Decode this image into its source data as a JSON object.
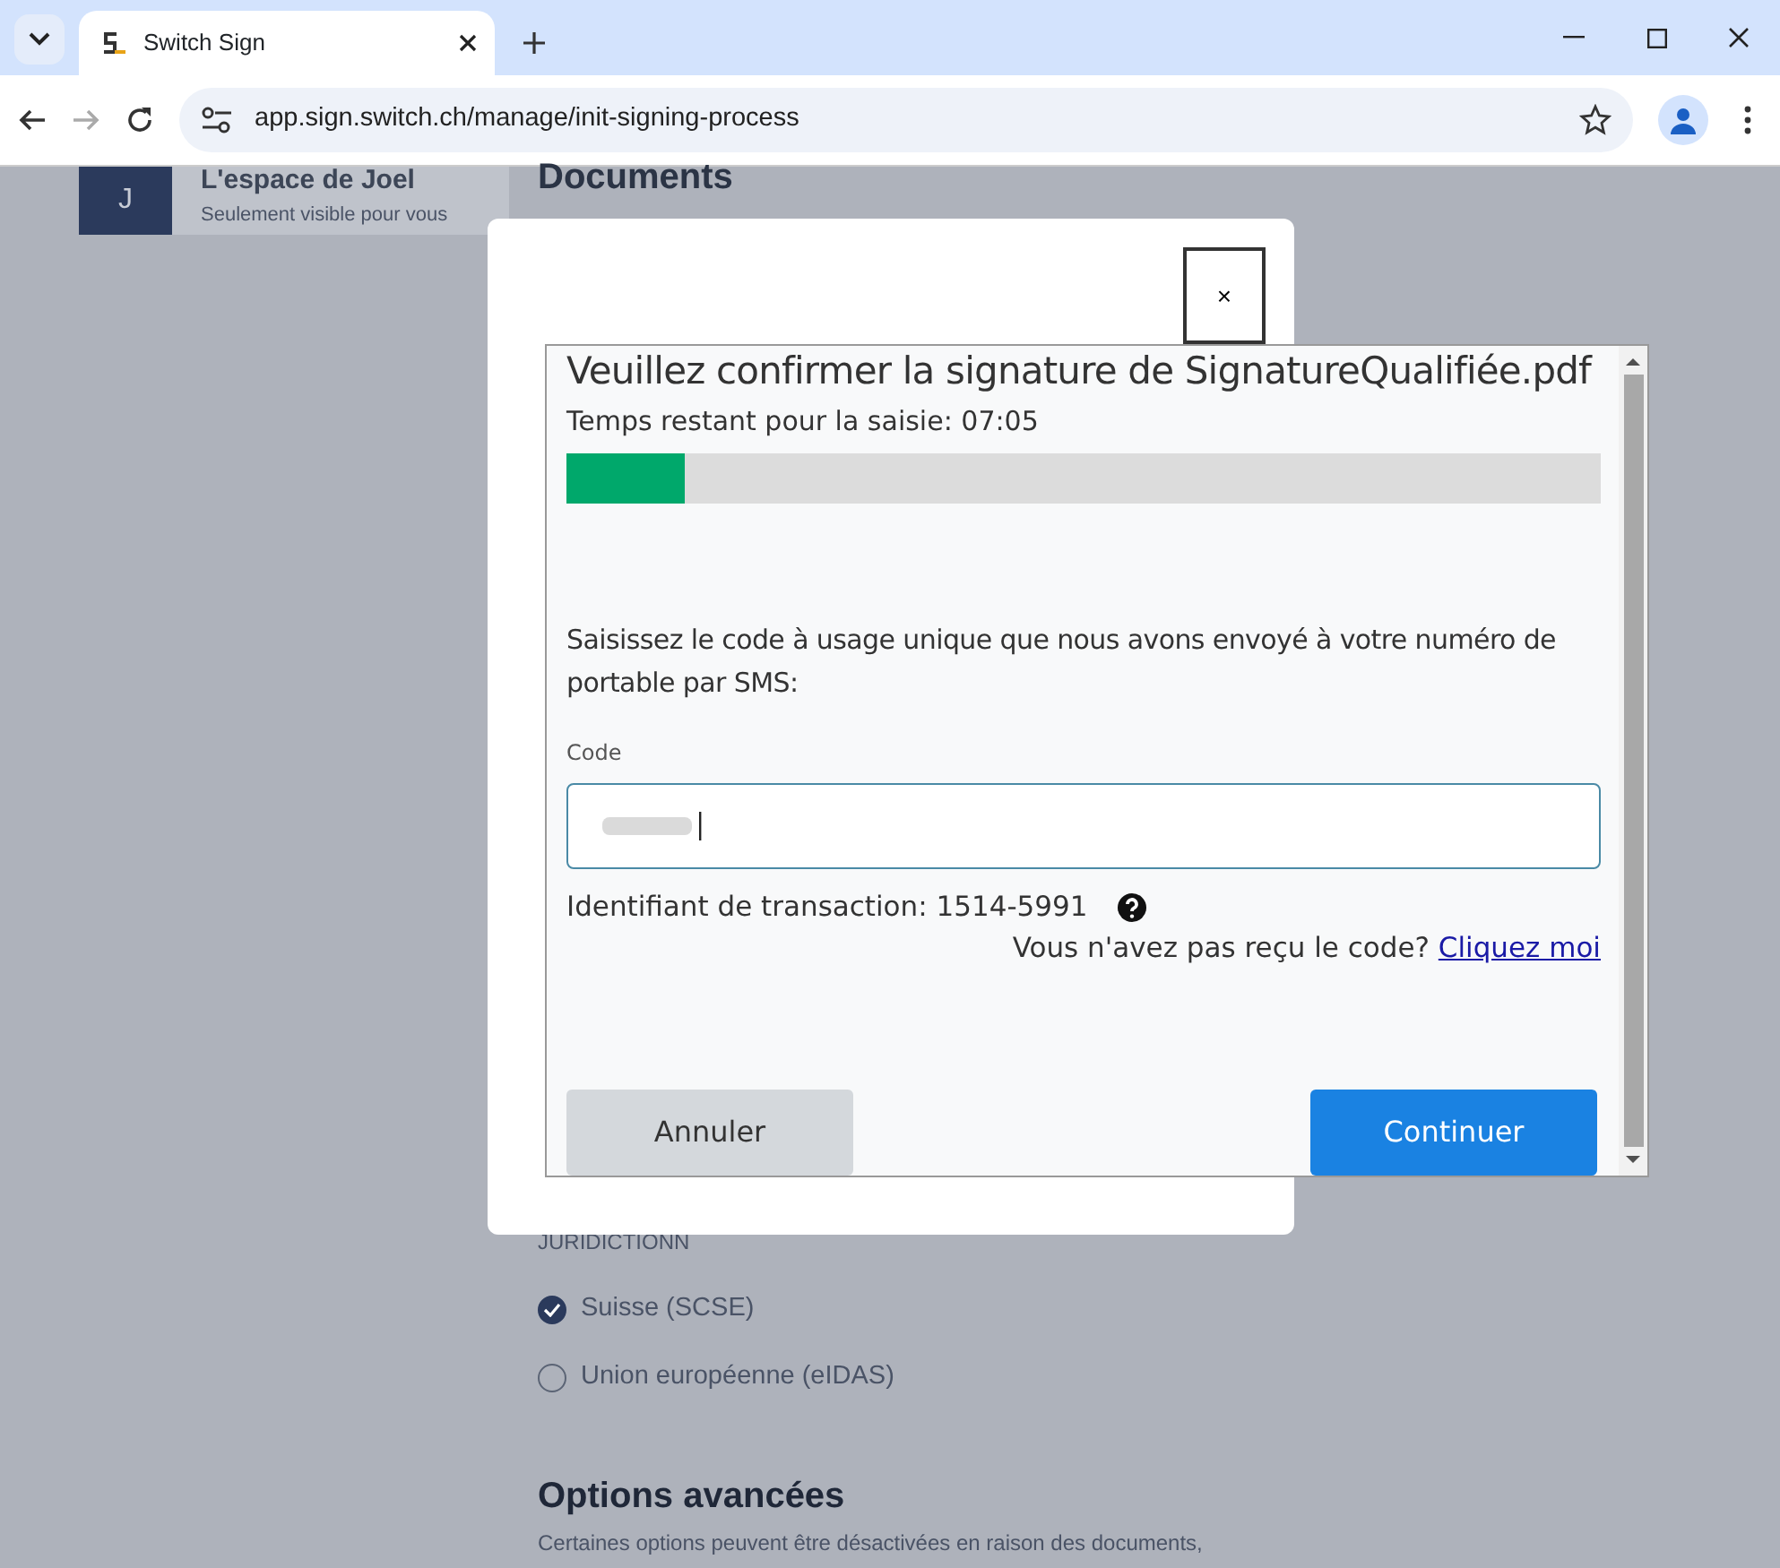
{
  "browser": {
    "tab": {
      "title": "Switch Sign",
      "selected": true
    },
    "url": "app.sign.switch.ch/manage/init-signing-process"
  },
  "background": {
    "workspace": {
      "initial": "J",
      "name": "L'espace de Joel",
      "subtitle": "Seulement visible pour vous"
    },
    "heading": "Documents",
    "section_label": "JURIDICTIONN",
    "options": [
      {
        "label": "Suisse (SCSE)",
        "selected": true
      },
      {
        "label": "Union européenne (eIDAS)",
        "selected": false
      }
    ],
    "advanced": {
      "title": "Options avancées",
      "description": "Certaines options peuvent être désactivées en raison des documents,"
    }
  },
  "dialog": {
    "close": "×",
    "title": "Veuillez confirmer la signature de SignatureQualifiée.pdf",
    "timer": "Temps restant pour la saisie: 07:05",
    "progress": {
      "level": 0.115
    },
    "instruction": "Saisissez le code à usage unique que nous avons envoyé à votre numéro de portable par SMS:",
    "code_label": "Code",
    "transaction": "Identifiant de transaction: 1514-5991",
    "resend_prompt": "Vous n'avez pas reçu le code?",
    "resend_link": "Cliquez moi",
    "buttons": [
      {
        "label": "Annuler",
        "kind": "secondary"
      },
      {
        "label": "Continuer",
        "kind": "primary"
      }
    ]
  }
}
